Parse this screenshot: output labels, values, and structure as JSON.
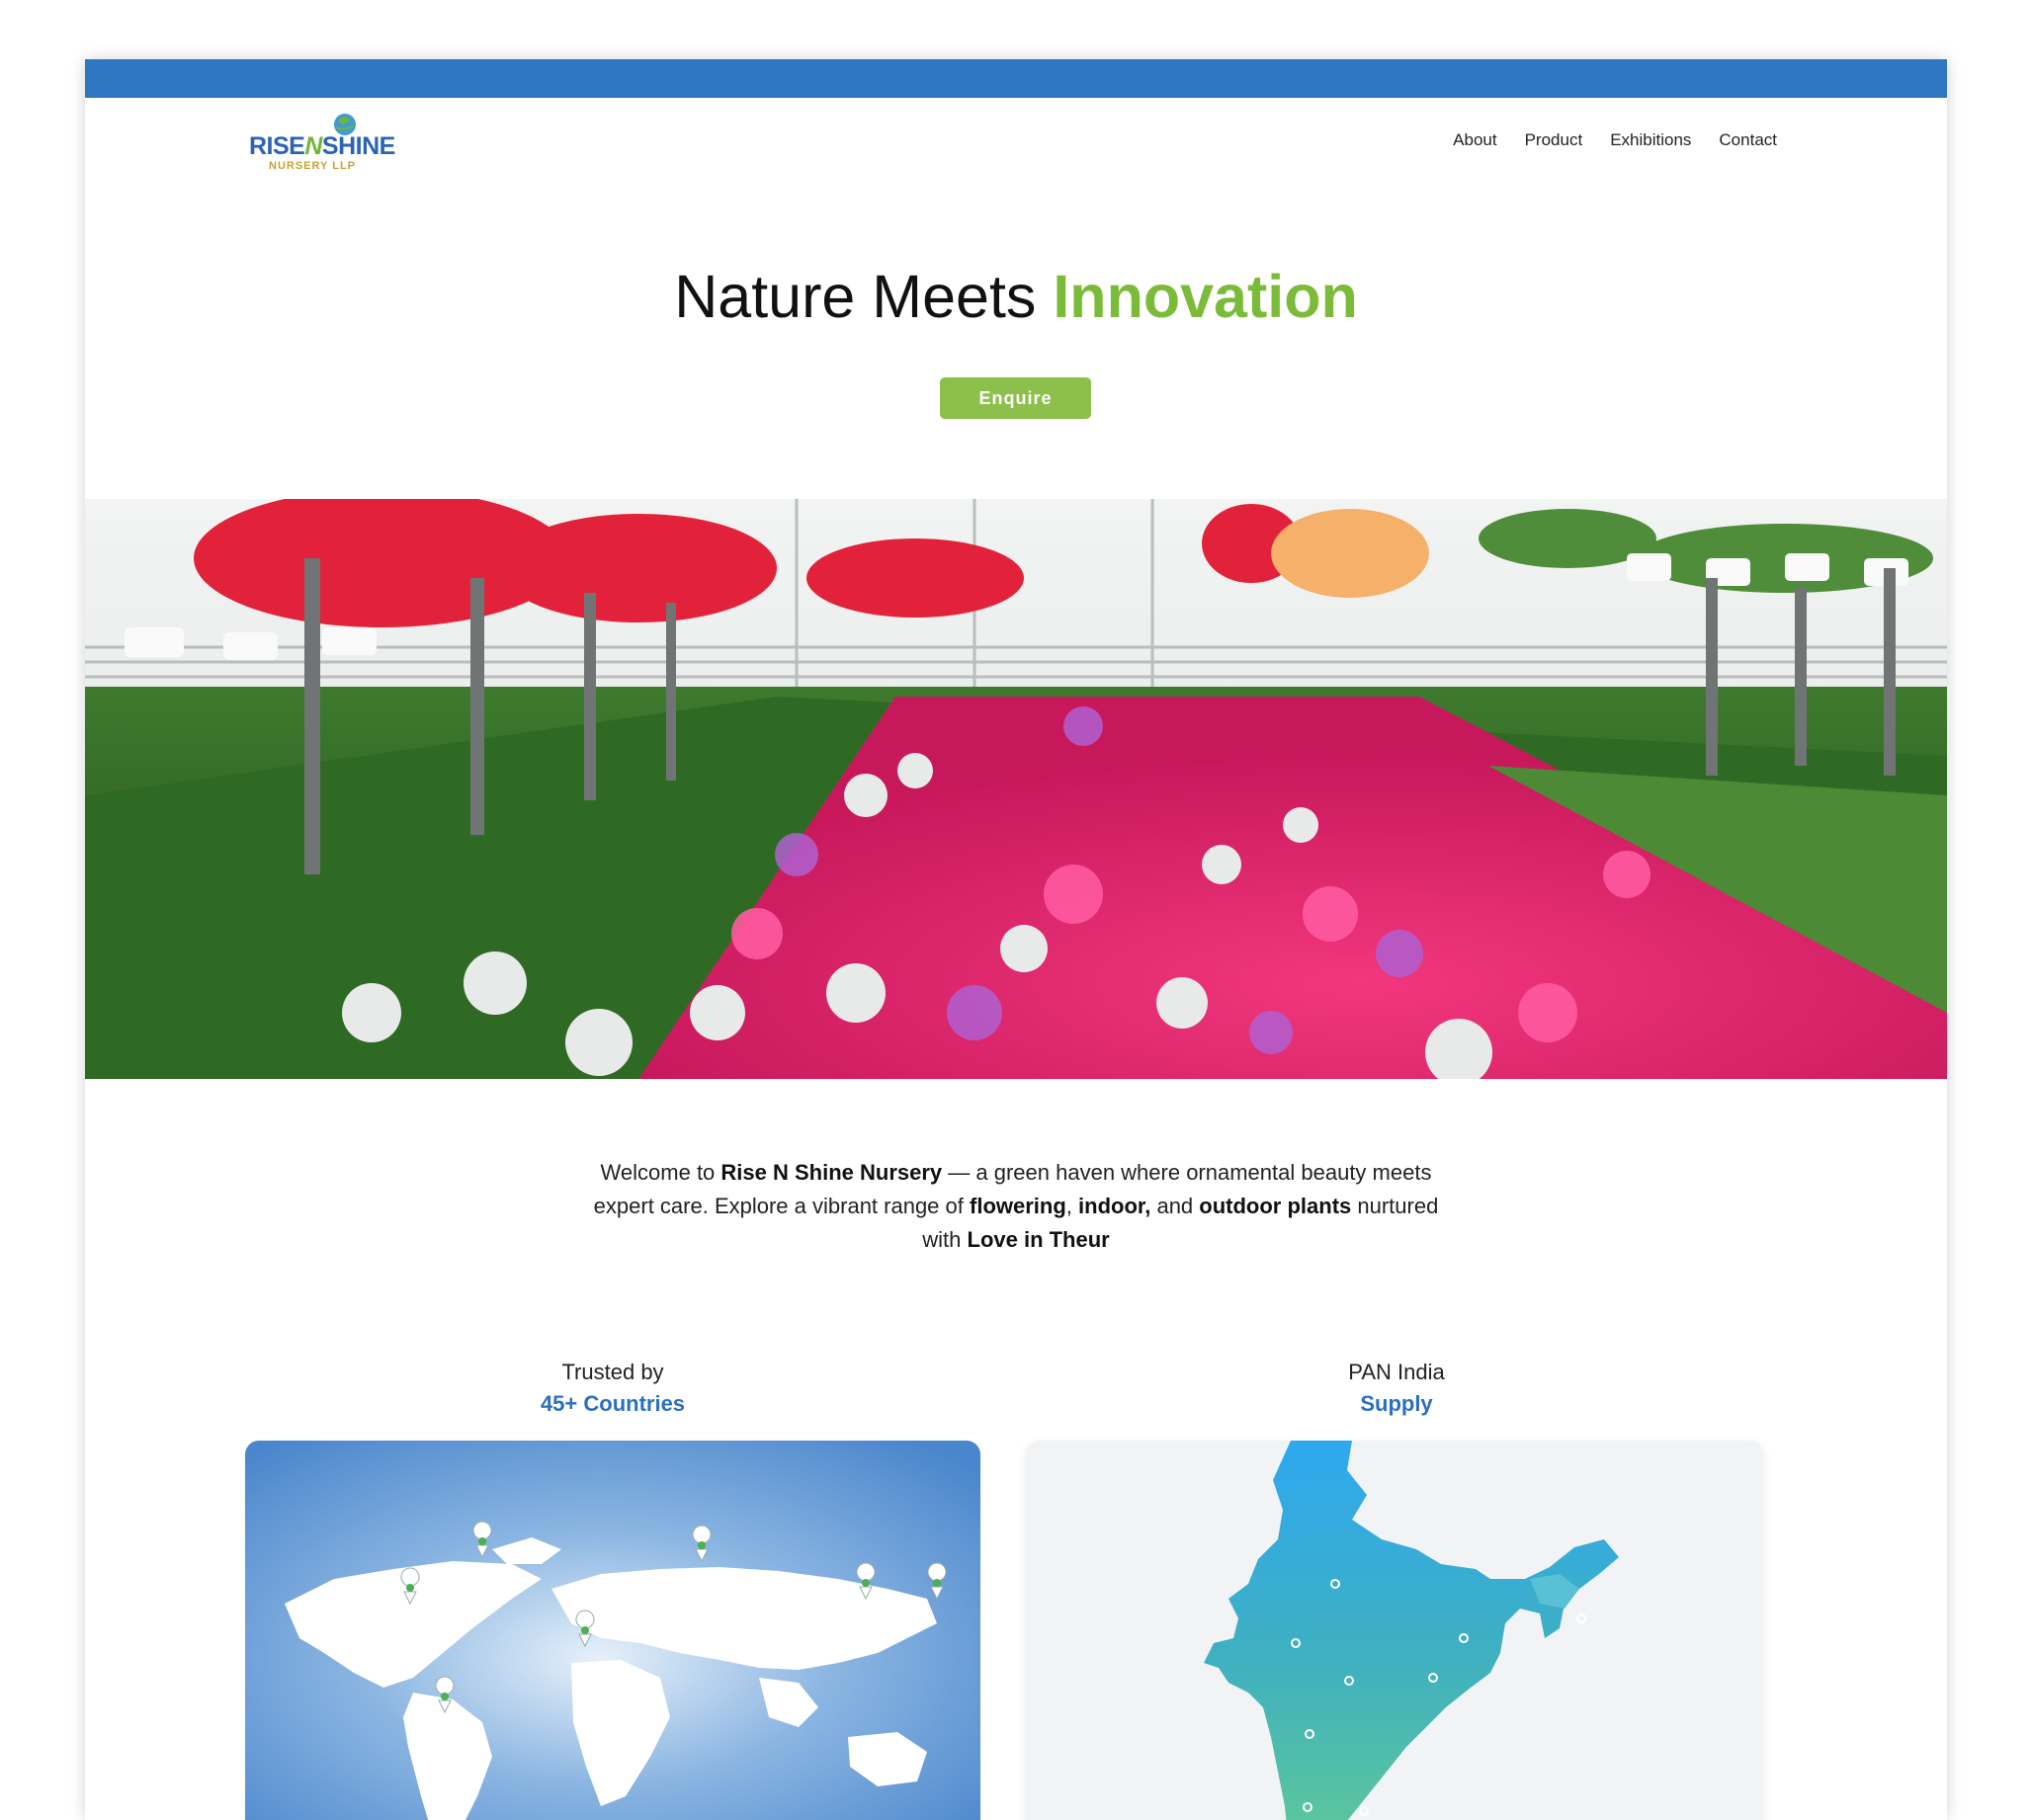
{
  "logo": {
    "main_left": "RISE",
    "main_n": "N",
    "main_right": "SHINE",
    "sub": "NURSERY LLP"
  },
  "nav": {
    "about": "About",
    "product": "Product",
    "exhibitions": "Exhibitions",
    "contact": "Contact"
  },
  "hero": {
    "title_plain": "Nature Meets ",
    "title_accent": "Innovation",
    "cta": "Enquire"
  },
  "welcome": {
    "t1": "Welcome to ",
    "b1": "Rise N Shine Nursery",
    "t2": " — a green haven where ornamental beauty meets expert care. Explore a vibrant range of ",
    "b2": "flowering",
    "t3": ", ",
    "b3": "indoor,",
    "t4": " and ",
    "b4": "outdoor plants",
    "t5": " nurtured with ",
    "b5": "Love in Theur"
  },
  "stats": {
    "left": {
      "line1": "Trusted by",
      "line2": "45+ Countries"
    },
    "right": {
      "line1": "PAN India",
      "line2": "Supply"
    }
  },
  "colors": {
    "topbar": "#2f77c3",
    "accent_green": "#7cbb3a",
    "button": "#8cc04a",
    "link_blue": "#2b6fc0"
  },
  "icons": {
    "world_markers": "map-pin-icon",
    "india_markers": "location-dot-icon"
  }
}
